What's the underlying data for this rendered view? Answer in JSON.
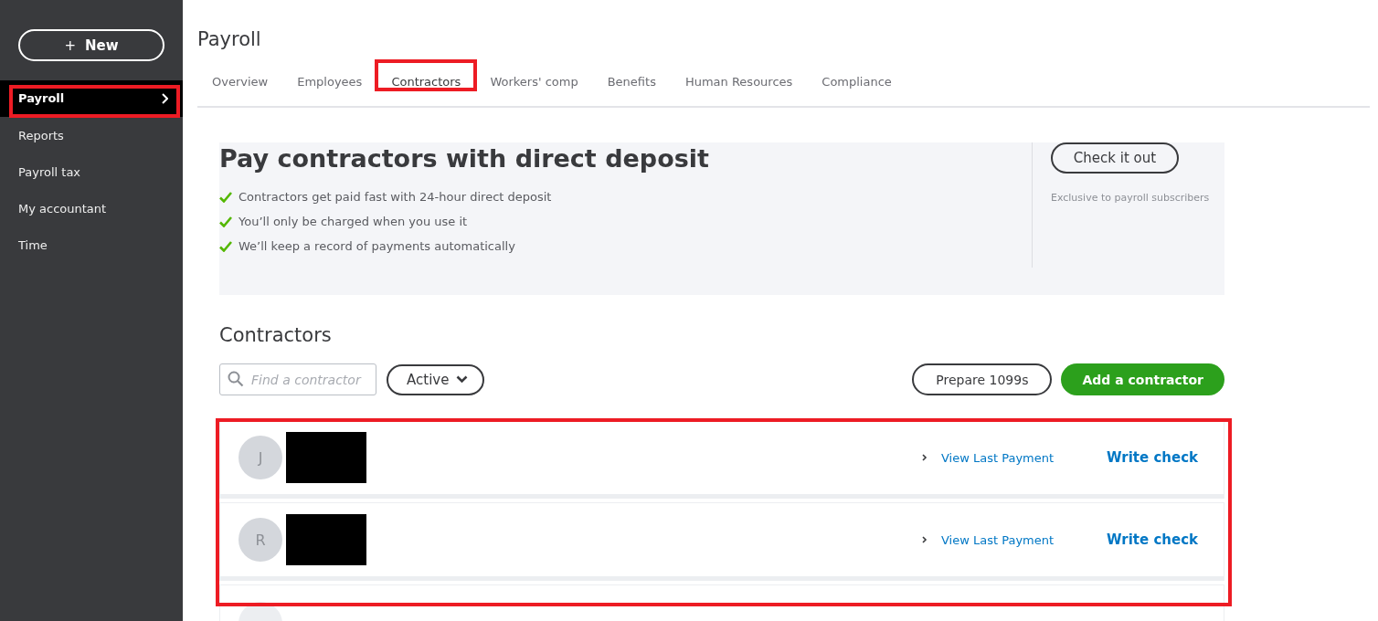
{
  "sidebar": {
    "new_button": {
      "icon_text": "+",
      "label": "New"
    },
    "items": [
      {
        "label": "Payroll",
        "selected": true,
        "highlighted": true
      },
      {
        "label": "Reports",
        "selected": false,
        "highlighted": false
      },
      {
        "label": "Payroll tax",
        "selected": false,
        "highlighted": false
      },
      {
        "label": "My accountant",
        "selected": false,
        "highlighted": false
      },
      {
        "label": "Time",
        "selected": false,
        "highlighted": false
      }
    ]
  },
  "page_title": "Payroll",
  "tabs": [
    {
      "label": "Overview",
      "selected": false,
      "highlighted": false
    },
    {
      "label": "Employees",
      "selected": false,
      "highlighted": false
    },
    {
      "label": "Contractors",
      "selected": true,
      "highlighted": true
    },
    {
      "label": "Workers' comp",
      "selected": false,
      "highlighted": false
    },
    {
      "label": "Benefits",
      "selected": false,
      "highlighted": false
    },
    {
      "label": "Human Resources",
      "selected": false,
      "highlighted": false
    },
    {
      "label": "Compliance",
      "selected": false,
      "highlighted": false
    }
  ],
  "promo": {
    "title": "Pay contractors with direct deposit",
    "bullets": [
      "Contractors get paid fast with 24-hour direct deposit",
      "You’ll only be charged when you use it",
      "We’ll keep a record of payments automatically"
    ],
    "button": "Check it out",
    "note": "Exclusive to payroll subscribers"
  },
  "contractors": {
    "heading": "Contractors",
    "search": {
      "placeholder": "Find a contractor"
    },
    "filter": "Active",
    "prepare_button": "Prepare 1099s",
    "add_button": "Add a contractor",
    "highlighted": true,
    "rows": [
      {
        "initial": "J",
        "link": "View Last Payment",
        "action": "Write check"
      },
      {
        "initial": "R",
        "link": "View Last Payment",
        "action": "Write check"
      }
    ]
  }
}
